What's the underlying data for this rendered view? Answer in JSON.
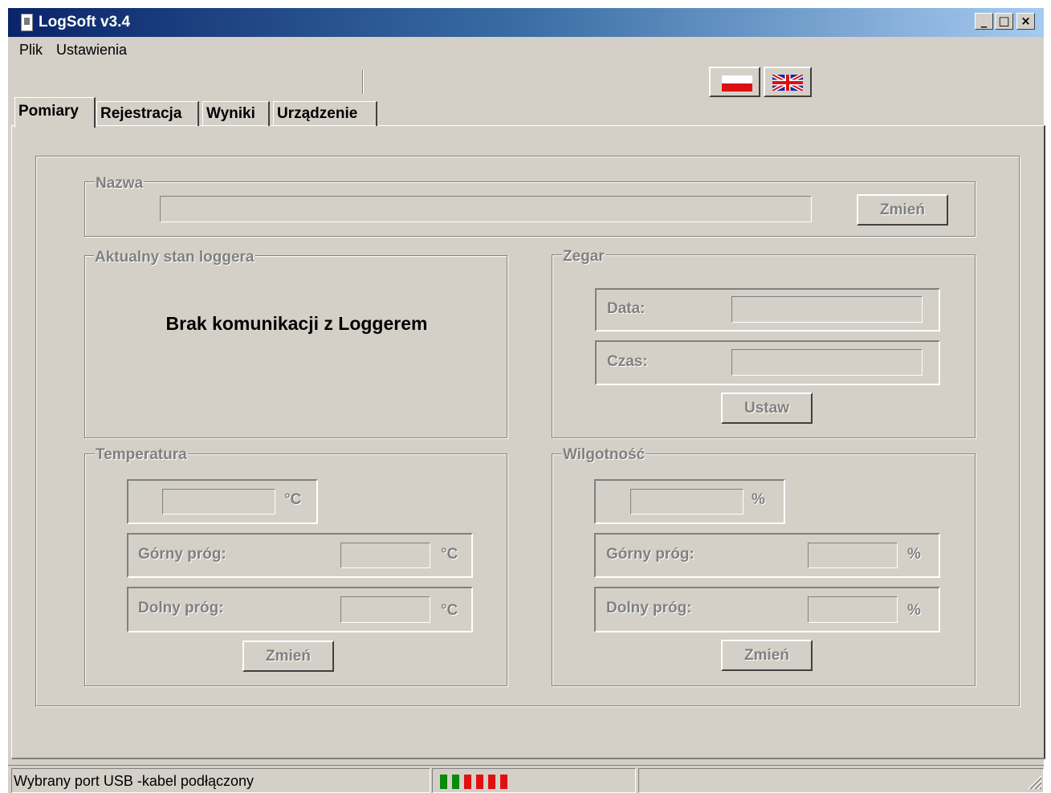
{
  "window": {
    "title": "LogSoft v3.4",
    "controls": [
      "_",
      "□",
      "×"
    ]
  },
  "menu": {
    "items": [
      "Plik",
      "Ustawienia"
    ]
  },
  "language": {
    "polish_icon": "flag-pl-icon",
    "english_icon": "flag-uk-icon"
  },
  "tabs": [
    {
      "label": "Pomiary",
      "active": true
    },
    {
      "label": "Rejestracja",
      "active": false
    },
    {
      "label": "Wyniki",
      "active": false
    },
    {
      "label": "Urządzenie",
      "active": false
    }
  ],
  "name_group": {
    "title": "Nazwa",
    "value": "",
    "button": "Zmień"
  },
  "status_group": {
    "title": "Aktualny stan loggera",
    "message": "Brak komunikacji z Loggerem"
  },
  "clock_group": {
    "title": "Zegar",
    "date_label": "Data:",
    "date_value": "",
    "time_label": "Czas:",
    "time_value": "",
    "button": "Ustaw"
  },
  "temperature_group": {
    "title": "Temperatura",
    "value": "",
    "unit": "°C",
    "upper_label": "Górny próg:",
    "upper_value": "",
    "lower_label": "Dolny próg:",
    "lower_value": "",
    "button": "Zmień"
  },
  "humidity_group": {
    "title": "Wilgotność",
    "value": "",
    "unit": "%",
    "upper_label": "Górny próg:",
    "upper_value": "",
    "lower_label": "Dolny próg:",
    "lower_value": "",
    "button": "Zmień"
  },
  "statusbar": {
    "port_text": "Wybrany port USB  -kabel podłączony",
    "indicator_colors": [
      "#0a8a0a",
      "#0a8a0a",
      "#e01010",
      "#e01010",
      "#e01010",
      "#e01010"
    ],
    "colors": {
      "green": "#0a8a0a",
      "red": "#e01010"
    }
  }
}
